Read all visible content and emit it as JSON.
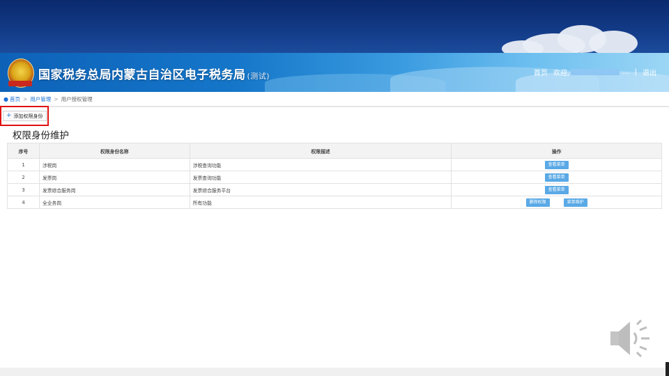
{
  "header": {
    "site_title": "国家税务总局内蒙古自治区电子税务局",
    "site_tag": "(测试)",
    "nav_home": "首页",
    "nav_welcome": "欢迎,",
    "nav_dots": "...",
    "nav_sep": "|",
    "nav_logout": "退出"
  },
  "breadcrumb": {
    "home": "首页",
    "level1": "用户管理",
    "current": "用户授权管理",
    "arrow": ">"
  },
  "toolbar": {
    "add_label": "添加权限身份",
    "add_icon": "plus-icon"
  },
  "main": {
    "title": "权限身份维护",
    "columns": [
      "序号",
      "权限身份名称",
      "权限描述",
      "操作"
    ],
    "rows": [
      {
        "no": "1",
        "name": "涉税岗",
        "desc": "涉税查询功能",
        "actions": [
          "查看菜单"
        ]
      },
      {
        "no": "2",
        "name": "发票岗",
        "desc": "发票查询功能",
        "actions": [
          "查看菜单"
        ]
      },
      {
        "no": "3",
        "name": "发票综合服务岗",
        "desc": "发票综合服务平台",
        "actions": [
          "查看菜单"
        ]
      },
      {
        "no": "4",
        "name": "全业务岗",
        "desc": "所有功能",
        "actions": [
          "删除权限",
          "菜单维护"
        ]
      }
    ]
  },
  "colors": {
    "accent": "#1a6fd6",
    "button_blue": "#5aa9e6",
    "highlight_red": "#e01010",
    "header_dark": "#0b2a6e"
  }
}
